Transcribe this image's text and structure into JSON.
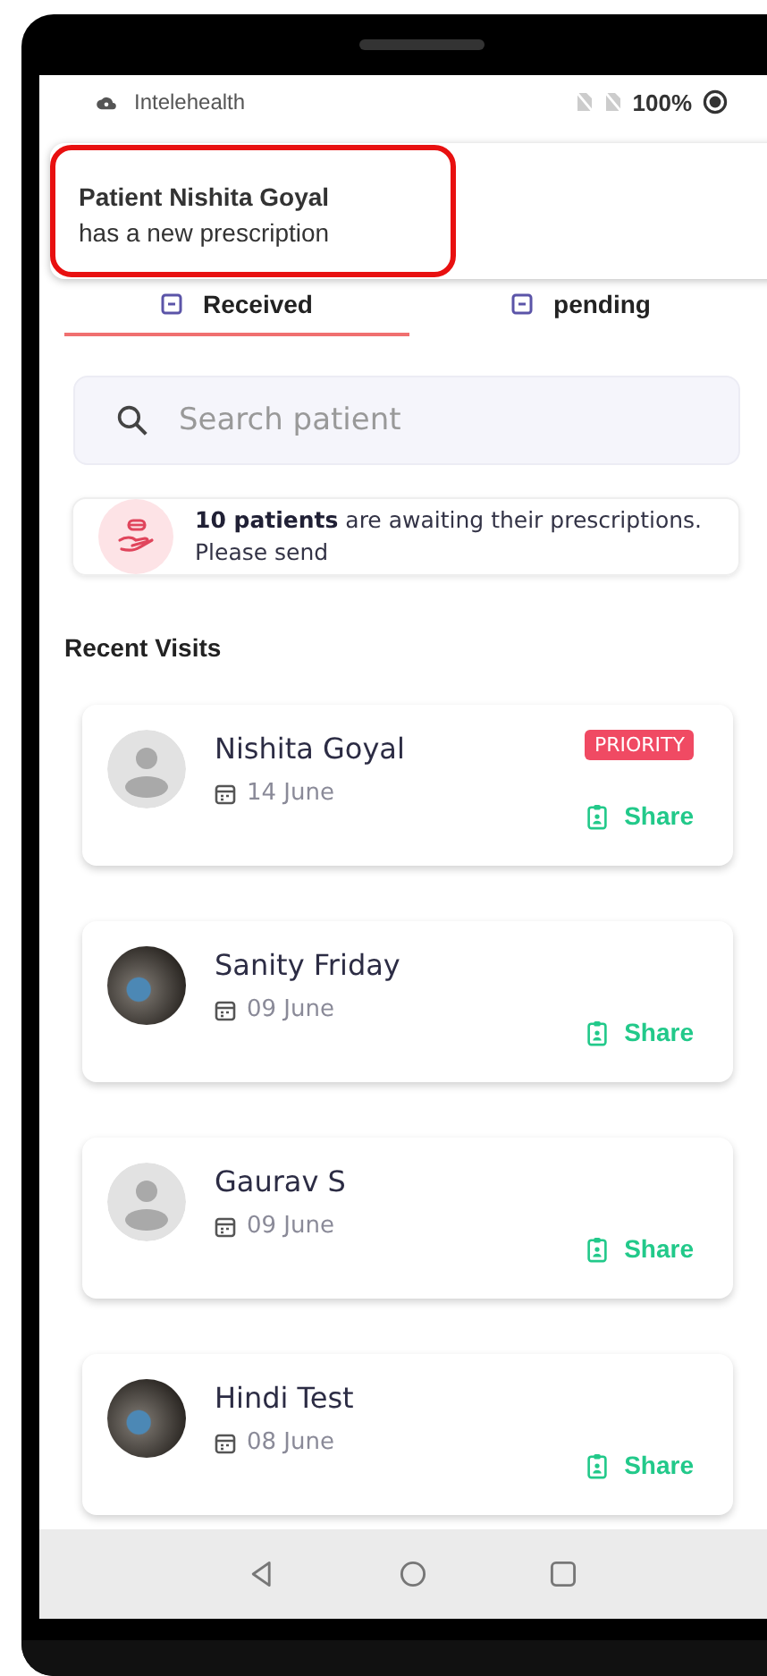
{
  "status_bar": {
    "app_name": "Intelehealth",
    "battery": "100%"
  },
  "notification": {
    "title": "Patient Nishita Goyal",
    "body": "has a new prescription",
    "highlighted": true
  },
  "tabs": [
    {
      "label": "Received",
      "selected": true
    },
    {
      "label": "pending",
      "selected": false
    }
  ],
  "search": {
    "placeholder": "Search patient"
  },
  "info_card": {
    "text": "**10 patients** are awaiting their prescriptions. Please send"
  },
  "section_title": "Recent Visits",
  "visits": [
    {
      "name": "Nishita Goyal",
      "date": "14 June",
      "kind": "default-avatar",
      "badge": "PRIORITY",
      "action": "Share"
    },
    {
      "name": "Sanity Friday",
      "date": "09 June",
      "kind": "photo-avatar",
      "action": "Share"
    },
    {
      "name": "Gaurav S",
      "date": "09 June",
      "kind": "default-avatar",
      "action": "Share"
    },
    {
      "name": "Hindi Test",
      "date": "08 June",
      "kind": "photo-avatar",
      "action": "Share"
    }
  ]
}
